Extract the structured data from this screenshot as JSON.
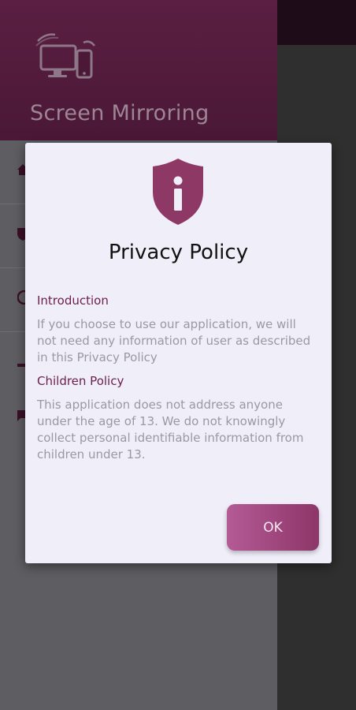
{
  "colors": {
    "accent": "#8d3669",
    "heading": "#6b1f4c",
    "drawer_header": "#4b1837",
    "dialog_bg": "#f0eef9"
  },
  "drawer": {
    "title": "Screen Mirroring",
    "logo_icon": "screen-mirroring-devices-icon",
    "items": [
      {
        "icon": "home-icon"
      },
      {
        "icon": "shield-icon"
      },
      {
        "icon": "info-icon"
      },
      {
        "icon": "share-icon"
      },
      {
        "icon": "feedback-icon"
      }
    ]
  },
  "dialog": {
    "icon": "shield-info-icon",
    "title": "Privacy Policy",
    "sections": [
      {
        "heading": "Introduction",
        "body": "If you choose to use our application, we will not need any information of user as described in this Privacy Policy"
      },
      {
        "heading": "Children Policy",
        "body": "This application does not address anyone under the age of 13. We do not knowingly collect personal identifiable information from children under 13."
      }
    ],
    "ok_label": "OK"
  }
}
